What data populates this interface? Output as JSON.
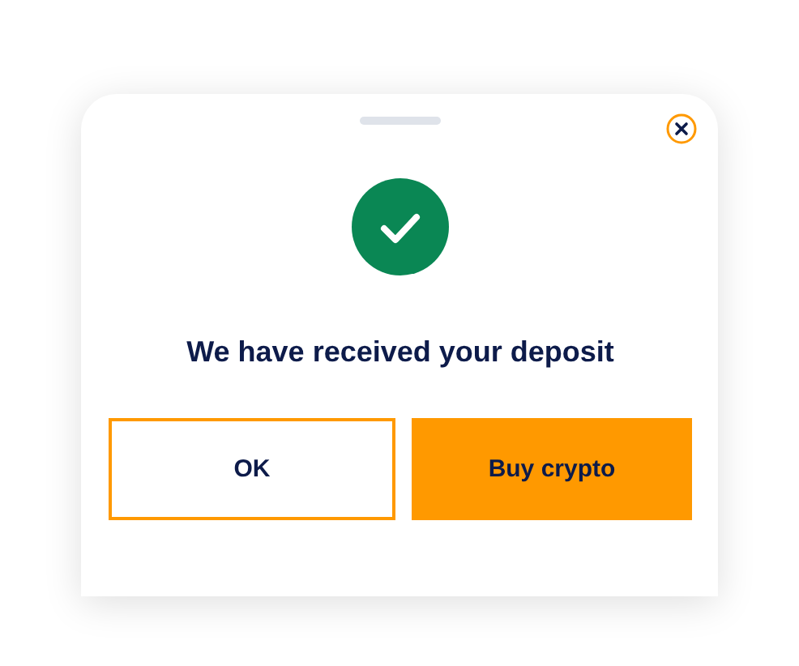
{
  "dialog": {
    "title": "We have received your deposit"
  },
  "buttons": [
    {
      "label": "OK",
      "kind": "secondary"
    },
    {
      "label": "Buy crypto",
      "kind": "primary"
    }
  ]
}
